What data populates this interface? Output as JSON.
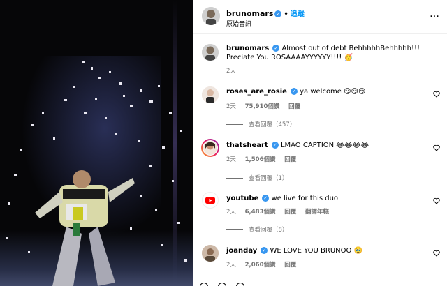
{
  "post_header": {
    "username": "brunomars",
    "separator": "•",
    "follow_label": "追蹤",
    "audio_label": "原始音訊",
    "menu_glyph": "…"
  },
  "caption": {
    "username": "brunomars",
    "text": "Almost out of debt BehhhhhBehhhhh!!! Preciate You ROSAAAAYYYYYY!!!! 🥳",
    "time": "2天"
  },
  "comments": [
    {
      "username": "roses_are_rosie",
      "text": "ya welcome 😏😏😏",
      "time": "2天",
      "likes": "75,910個讚",
      "reply_label": "回覆",
      "view_replies": "查看回覆（457）"
    },
    {
      "username": "thatsheart",
      "text": "LMAO CAPTION 😂😂😂😂",
      "time": "2天",
      "likes": "1,506個讚",
      "reply_label": "回覆",
      "view_replies": "查看回覆（1）"
    },
    {
      "username": "youtube",
      "text": "we live for this duo",
      "time": "2天",
      "likes": "6,483個讚",
      "reply_label": "回覆",
      "translate_label": "翻譯年糕",
      "view_replies": "查看回覆（8）"
    },
    {
      "username": "joanday",
      "text": "WE LOVE YOU BRUNOO 🥹",
      "time": "2天",
      "likes": "2,060個讚",
      "reply_label": "回覆"
    }
  ],
  "colors": {
    "verified": "#3897f0",
    "follow": "#0095f6",
    "youtube": "#ff0000",
    "meta_gray": "#737373"
  }
}
